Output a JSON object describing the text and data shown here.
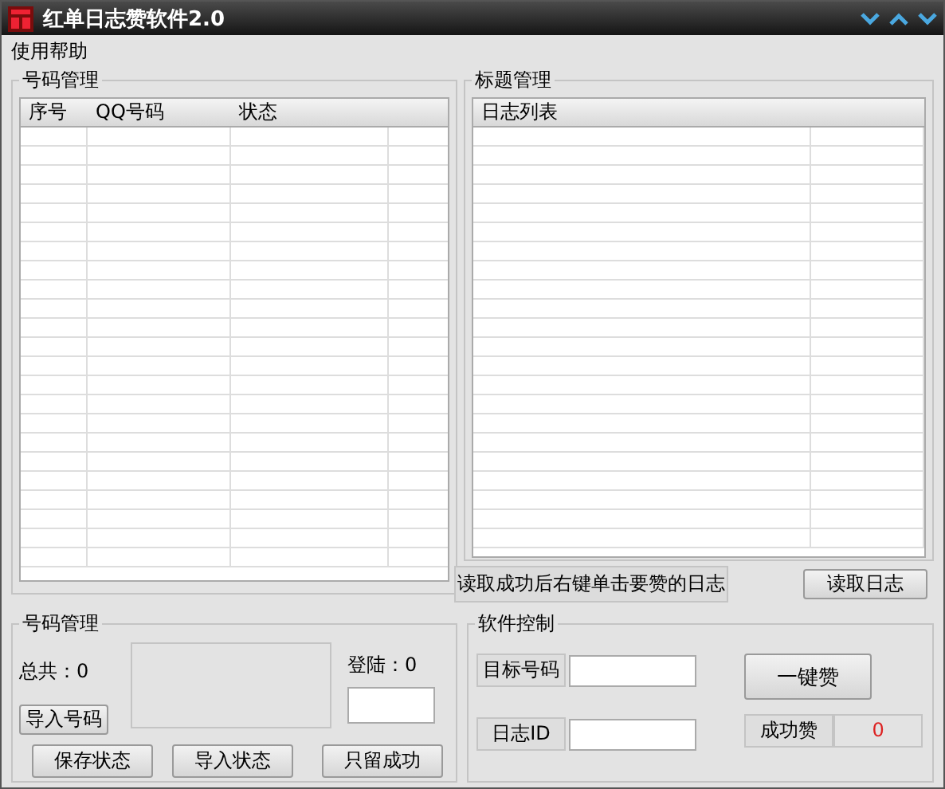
{
  "window": {
    "title": "红单日志赞软件2.0"
  },
  "menu": [
    "使用帮助"
  ],
  "number_panel": {
    "title": "号码管理",
    "columns": [
      "序号",
      "QQ号码",
      "状态"
    ]
  },
  "title_panel": {
    "title": "标题管理",
    "columns": [
      "日志列表"
    ],
    "hint": "读取成功后右键单击要赞的日志",
    "read_button": "读取日志"
  },
  "number_control": {
    "title": "号码管理",
    "total": "总共：0",
    "login": "登陆：0",
    "import_button": "导入号码",
    "buttons": [
      "保存状态",
      "导入状态",
      "只留成功"
    ]
  },
  "software_control": {
    "title": "软件控制",
    "target_label": "目标号码",
    "log_id_label": "日志ID",
    "like_button": "一键赞",
    "success_label": "成功赞",
    "success_count": "0"
  }
}
